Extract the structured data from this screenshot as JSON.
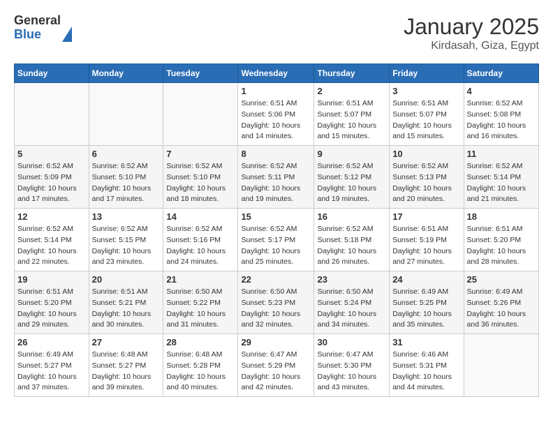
{
  "header": {
    "logo_general": "General",
    "logo_blue": "Blue",
    "title": "January 2025",
    "subtitle": "Kirdasah, Giza, Egypt"
  },
  "days_of_week": [
    "Sunday",
    "Monday",
    "Tuesday",
    "Wednesday",
    "Thursday",
    "Friday",
    "Saturday"
  ],
  "weeks": [
    [
      {
        "day": "",
        "info": ""
      },
      {
        "day": "",
        "info": ""
      },
      {
        "day": "",
        "info": ""
      },
      {
        "day": "1",
        "info": "Sunrise: 6:51 AM\nSunset: 5:06 PM\nDaylight: 10 hours and 14 minutes."
      },
      {
        "day": "2",
        "info": "Sunrise: 6:51 AM\nSunset: 5:07 PM\nDaylight: 10 hours and 15 minutes."
      },
      {
        "day": "3",
        "info": "Sunrise: 6:51 AM\nSunset: 5:07 PM\nDaylight: 10 hours and 15 minutes."
      },
      {
        "day": "4",
        "info": "Sunrise: 6:52 AM\nSunset: 5:08 PM\nDaylight: 10 hours and 16 minutes."
      }
    ],
    [
      {
        "day": "5",
        "info": "Sunrise: 6:52 AM\nSunset: 5:09 PM\nDaylight: 10 hours and 17 minutes."
      },
      {
        "day": "6",
        "info": "Sunrise: 6:52 AM\nSunset: 5:10 PM\nDaylight: 10 hours and 17 minutes."
      },
      {
        "day": "7",
        "info": "Sunrise: 6:52 AM\nSunset: 5:10 PM\nDaylight: 10 hours and 18 minutes."
      },
      {
        "day": "8",
        "info": "Sunrise: 6:52 AM\nSunset: 5:11 PM\nDaylight: 10 hours and 19 minutes."
      },
      {
        "day": "9",
        "info": "Sunrise: 6:52 AM\nSunset: 5:12 PM\nDaylight: 10 hours and 19 minutes."
      },
      {
        "day": "10",
        "info": "Sunrise: 6:52 AM\nSunset: 5:13 PM\nDaylight: 10 hours and 20 minutes."
      },
      {
        "day": "11",
        "info": "Sunrise: 6:52 AM\nSunset: 5:14 PM\nDaylight: 10 hours and 21 minutes."
      }
    ],
    [
      {
        "day": "12",
        "info": "Sunrise: 6:52 AM\nSunset: 5:14 PM\nDaylight: 10 hours and 22 minutes."
      },
      {
        "day": "13",
        "info": "Sunrise: 6:52 AM\nSunset: 5:15 PM\nDaylight: 10 hours and 23 minutes."
      },
      {
        "day": "14",
        "info": "Sunrise: 6:52 AM\nSunset: 5:16 PM\nDaylight: 10 hours and 24 minutes."
      },
      {
        "day": "15",
        "info": "Sunrise: 6:52 AM\nSunset: 5:17 PM\nDaylight: 10 hours and 25 minutes."
      },
      {
        "day": "16",
        "info": "Sunrise: 6:52 AM\nSunset: 5:18 PM\nDaylight: 10 hours and 26 minutes."
      },
      {
        "day": "17",
        "info": "Sunrise: 6:51 AM\nSunset: 5:19 PM\nDaylight: 10 hours and 27 minutes."
      },
      {
        "day": "18",
        "info": "Sunrise: 6:51 AM\nSunset: 5:20 PM\nDaylight: 10 hours and 28 minutes."
      }
    ],
    [
      {
        "day": "19",
        "info": "Sunrise: 6:51 AM\nSunset: 5:20 PM\nDaylight: 10 hours and 29 minutes."
      },
      {
        "day": "20",
        "info": "Sunrise: 6:51 AM\nSunset: 5:21 PM\nDaylight: 10 hours and 30 minutes."
      },
      {
        "day": "21",
        "info": "Sunrise: 6:50 AM\nSunset: 5:22 PM\nDaylight: 10 hours and 31 minutes."
      },
      {
        "day": "22",
        "info": "Sunrise: 6:50 AM\nSunset: 5:23 PM\nDaylight: 10 hours and 32 minutes."
      },
      {
        "day": "23",
        "info": "Sunrise: 6:50 AM\nSunset: 5:24 PM\nDaylight: 10 hours and 34 minutes."
      },
      {
        "day": "24",
        "info": "Sunrise: 6:49 AM\nSunset: 5:25 PM\nDaylight: 10 hours and 35 minutes."
      },
      {
        "day": "25",
        "info": "Sunrise: 6:49 AM\nSunset: 5:26 PM\nDaylight: 10 hours and 36 minutes."
      }
    ],
    [
      {
        "day": "26",
        "info": "Sunrise: 6:49 AM\nSunset: 5:27 PM\nDaylight: 10 hours and 37 minutes."
      },
      {
        "day": "27",
        "info": "Sunrise: 6:48 AM\nSunset: 5:27 PM\nDaylight: 10 hours and 39 minutes."
      },
      {
        "day": "28",
        "info": "Sunrise: 6:48 AM\nSunset: 5:28 PM\nDaylight: 10 hours and 40 minutes."
      },
      {
        "day": "29",
        "info": "Sunrise: 6:47 AM\nSunset: 5:29 PM\nDaylight: 10 hours and 42 minutes."
      },
      {
        "day": "30",
        "info": "Sunrise: 6:47 AM\nSunset: 5:30 PM\nDaylight: 10 hours and 43 minutes."
      },
      {
        "day": "31",
        "info": "Sunrise: 6:46 AM\nSunset: 5:31 PM\nDaylight: 10 hours and 44 minutes."
      },
      {
        "day": "",
        "info": ""
      }
    ]
  ]
}
